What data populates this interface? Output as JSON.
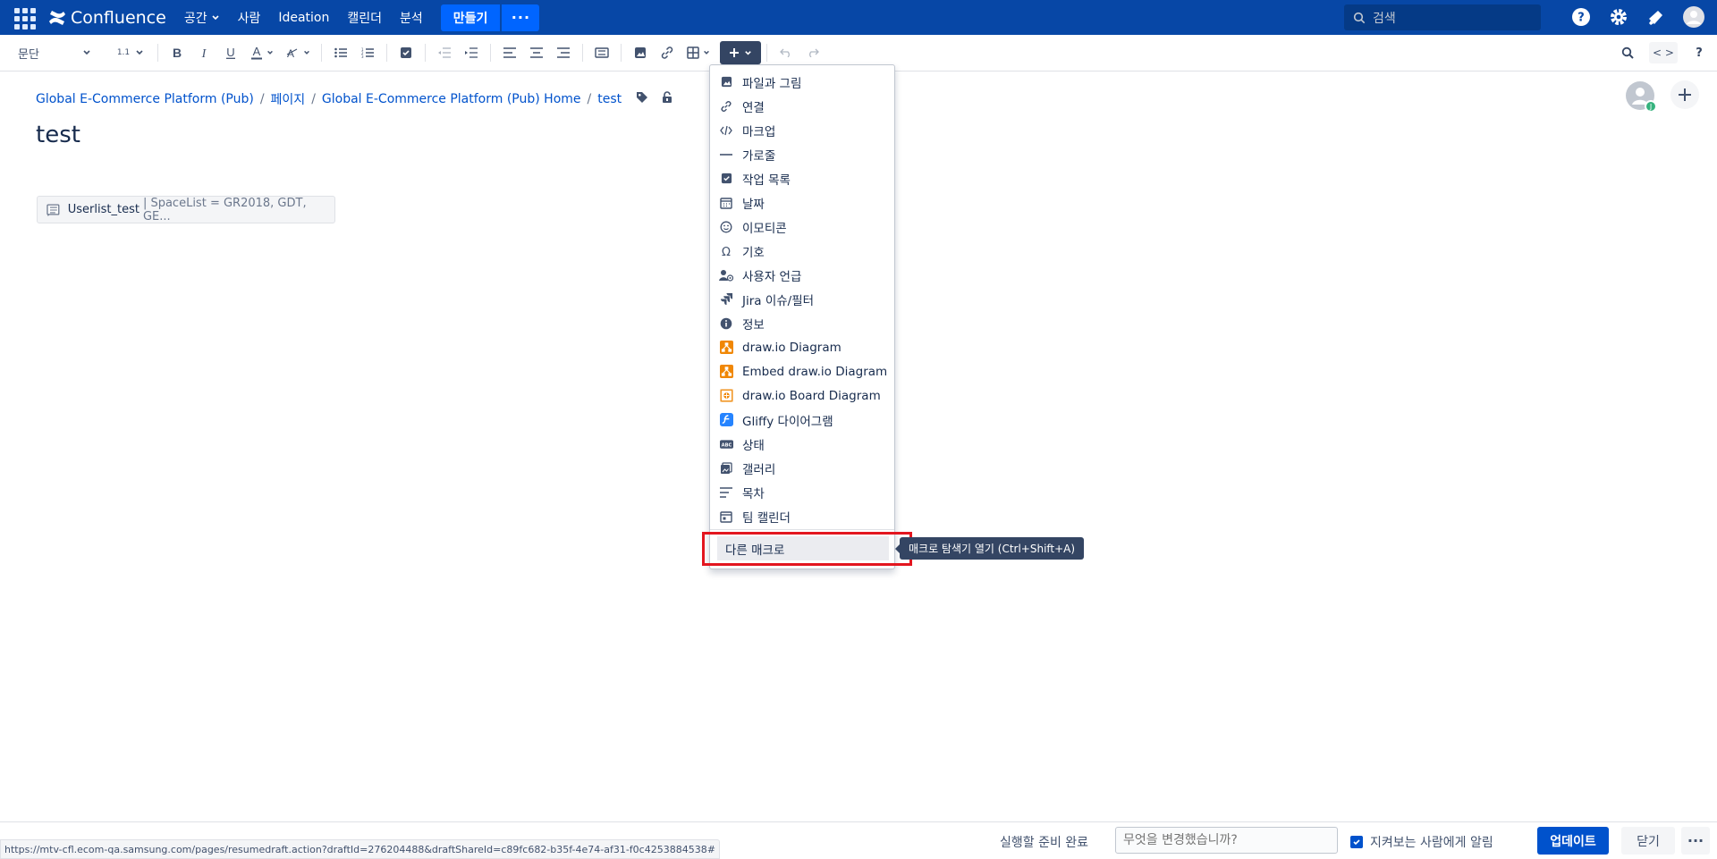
{
  "topnav": {
    "logo_text": "Confluence",
    "items": [
      {
        "label": "공간",
        "dropdown": true
      },
      {
        "label": "사람",
        "dropdown": false
      },
      {
        "label": "Ideation",
        "dropdown": false
      },
      {
        "label": "캘린더",
        "dropdown": false
      },
      {
        "label": "분석",
        "dropdown": false
      }
    ],
    "create_label": "만들기",
    "more_label": "···",
    "search_placeholder": "검색",
    "brand_color": "#0747a6"
  },
  "toolbar": {
    "paragraph_style": "문단",
    "line_spacing": "1.1",
    "code_label": "< >",
    "help_label": "?"
  },
  "breadcrumb": {
    "items": [
      "Global E-Commerce Platform (Pub)",
      "페이지",
      "Global E-Commerce Platform (Pub) Home",
      "test"
    ],
    "separator": "/"
  },
  "page": {
    "title": "test",
    "macro": {
      "name": "Userlist_test",
      "params": "| SpaceList = GR2018, GDT, GE..."
    }
  },
  "insert_menu": {
    "items": [
      {
        "icon": "image-icon",
        "label": "파일과 그림"
      },
      {
        "icon": "link-icon",
        "label": "연결"
      },
      {
        "icon": "code-icon",
        "label": "마크업"
      },
      {
        "icon": "horizontal-rule-icon",
        "label": "가로줄"
      },
      {
        "icon": "task-list-icon",
        "label": "작업 목록"
      },
      {
        "icon": "calendar-icon",
        "label": "날짜"
      },
      {
        "icon": "emoticon-icon",
        "label": "이모티콘"
      },
      {
        "icon": "omega-icon",
        "label": "기호"
      },
      {
        "icon": "user-mention-icon",
        "label": "사용자 언급"
      },
      {
        "icon": "jira-icon",
        "label": "Jira 이슈/필터"
      },
      {
        "icon": "info-icon",
        "label": "정보"
      },
      {
        "icon": "drawio-icon",
        "label": "draw.io Diagram"
      },
      {
        "icon": "drawio-embed-icon",
        "label": "Embed draw.io Diagram"
      },
      {
        "icon": "drawio-board-icon",
        "label": "draw.io Board Diagram"
      },
      {
        "icon": "gliffy-icon",
        "label": "Gliffy 다이어그램"
      },
      {
        "icon": "status-icon",
        "label": "상태"
      },
      {
        "icon": "gallery-icon",
        "label": "갤러리"
      },
      {
        "icon": "toc-icon",
        "label": "목차"
      },
      {
        "icon": "team-calendar-icon",
        "label": "팀 캘린더"
      }
    ],
    "other_macros_label": "다른 매크로",
    "tooltip": "매크로 탐색기 열기 (Ctrl+Shift+A)"
  },
  "footer": {
    "status_url": "https://mtv-cfl.ecom-qa.samsung.com/pages/resumedraft.action?draftId=276204488&draftShareId=c89fc682-b35f-4e74-af31-f0c4253884538#",
    "ready_text": "실행할 준비 완료",
    "change_placeholder": "무엇을 변경했습니까?",
    "notify_label": "지켜보는 사람에게 알림",
    "notify_checked": true,
    "update_label": "업데이트",
    "close_label": "닫기",
    "more_label": "···"
  },
  "colors": {
    "accent": "#0052cc",
    "highlight_box": "#e3161f",
    "drawio_orange": "#f08705",
    "gliffy_blue": "#2684ff"
  }
}
